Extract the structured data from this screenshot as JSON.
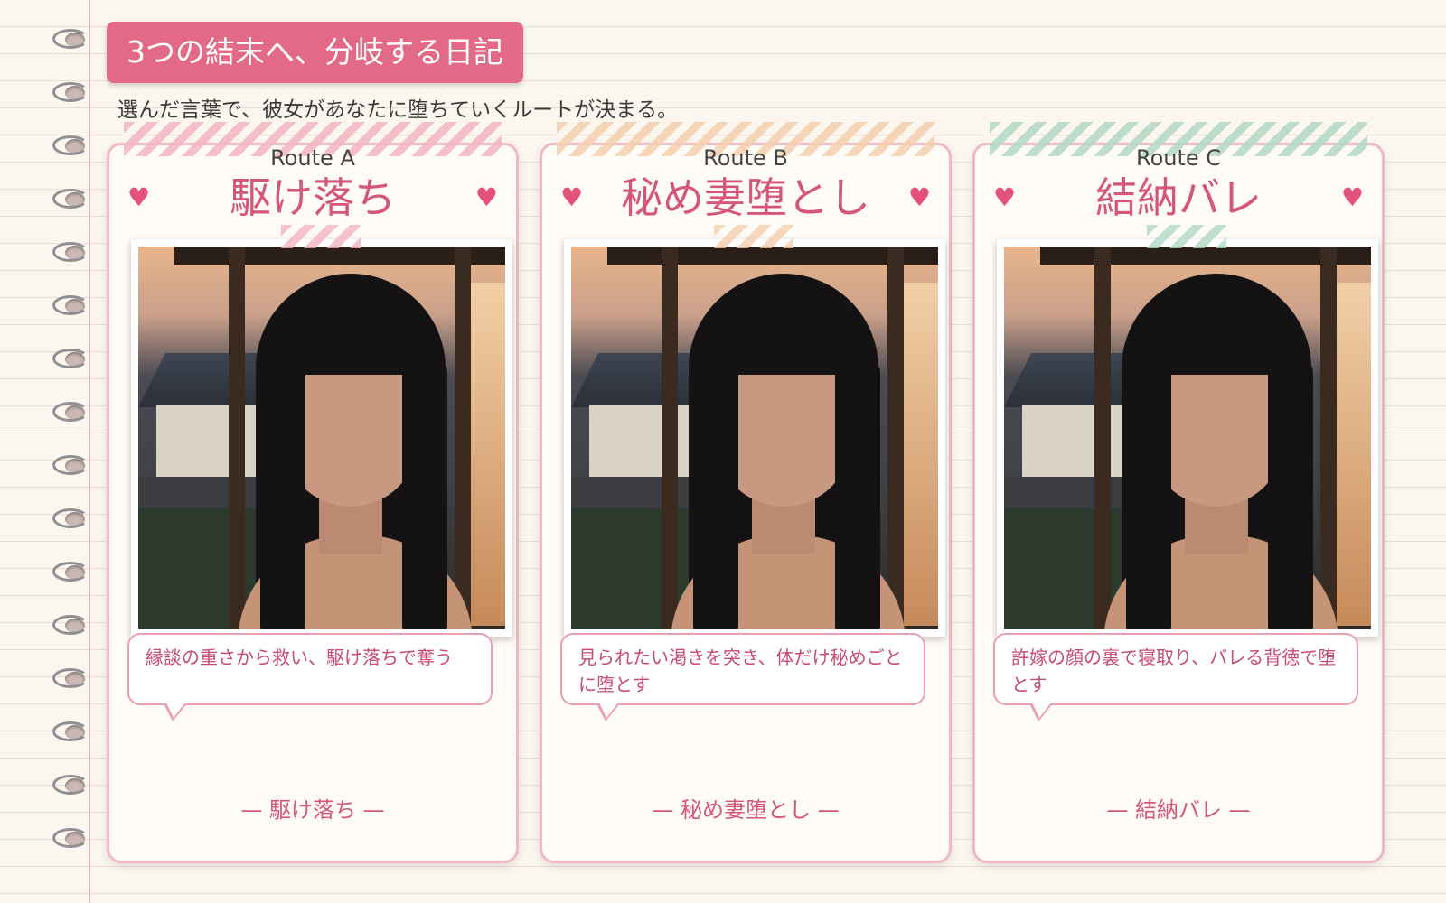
{
  "header": {
    "title": "3つの結末へ、分岐する日記",
    "subtitle": "選んだ言葉で、彼女があなたに堕ちていくルートが決まる。"
  },
  "routes": [
    {
      "label": "Route A",
      "name": "駆け落ち",
      "caption": "縁談の重さから救い、駆け落ちで奪う",
      "footer": "— 駆け落ち —"
    },
    {
      "label": "Route B",
      "name": "秘め妻堕とし",
      "caption": "見られたい渇きを突き、体だけ秘めごとに堕とす",
      "footer": "— 秘め妻堕とし —"
    },
    {
      "label": "Route C",
      "name": "結納バレ",
      "caption": "許嫁の顔の裏で寝取り、バレる背徳で堕とす",
      "footer": "— 結納バレ —"
    }
  ],
  "colors": {
    "accent": "#e36a87",
    "route_text": "#d4577b",
    "tape_a": "#f3b4c3",
    "tape_b": "#f4cfae",
    "tape_c": "#b2d8c6"
  },
  "icons": [
    "heart-icon",
    "notebook-ring-icon"
  ]
}
